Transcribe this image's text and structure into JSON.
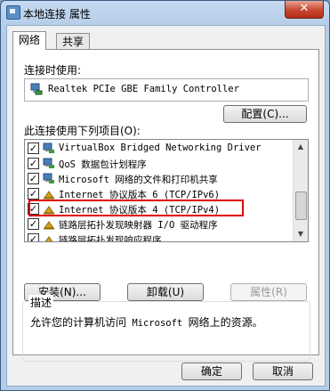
{
  "window": {
    "title": "本地连接 属性",
    "close_label": "✕"
  },
  "tabs": [
    {
      "label": "网络",
      "active": true
    },
    {
      "label": "共享",
      "active": false
    }
  ],
  "connect_using": {
    "label": "连接时使用:",
    "adapter": "Realtek PCIe GBE Family Controller",
    "configure_button": "配置(C)..."
  },
  "items_section": {
    "label": "此连接使用下列项目(O):",
    "items": [
      {
        "text": "VirtualBox Bridged Networking Driver",
        "checked": true,
        "icon": "network-client-icon"
      },
      {
        "text": "QoS 数据包计划程序",
        "checked": true,
        "icon": "network-client-icon"
      },
      {
        "text": "Microsoft 网络的文件和打印机共享",
        "checked": true,
        "icon": "network-client-icon"
      },
      {
        "text": "Internet 协议版本 6 (TCP/IPv6)",
        "checked": true,
        "icon": "protocol-icon"
      },
      {
        "text": "Internet 协议版本 4 (TCP/IPv4)",
        "checked": true,
        "icon": "protocol-icon"
      },
      {
        "text": "链路层拓扑发现映射器 I/O 驱动程序",
        "checked": true,
        "icon": "protocol-icon"
      },
      {
        "text": "链路层拓扑发现响应程序",
        "checked": true,
        "icon": "protocol-icon"
      }
    ]
  },
  "actions": {
    "install": "安装(N)...",
    "uninstall": "卸载(U)",
    "properties": "属性(R)"
  },
  "description": {
    "title": "描述",
    "text_prefix": "允许您的计算机访问",
    "text_mono": " Microsoft ",
    "text_suffix": "网络上的资源。"
  },
  "footer": {
    "ok": "确定",
    "cancel": "取消"
  },
  "colors": {
    "highlight": "#e00000",
    "protocol_icon": "#d4a017"
  }
}
